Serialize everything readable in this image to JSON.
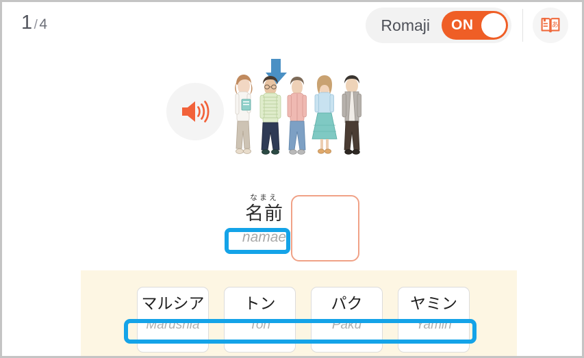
{
  "topbar": {
    "page_current": "1",
    "page_separator": "/",
    "page_total": "4",
    "romaji_label": "Romaji",
    "romaji_state": "ON",
    "dictionary_icon": "book-dictionary-icon"
  },
  "stage": {
    "audio_icon": "speaker-icon",
    "arrow_icon": "arrow-down-icon",
    "people_illustration": "five-standing-people-illustration",
    "people": [
      {
        "top_color": "#f4f2ef",
        "bottom_color": "#cdc3b4",
        "hair_color": "#c08a5e",
        "accent": "#8fd0c9"
      },
      {
        "top_color": "#dfeccb",
        "bottom_color": "#2e3a55",
        "hair_color": "#4a3b2f",
        "accent": "#c5d9a4"
      },
      {
        "top_color": "#efb9b2",
        "bottom_color": "#7da0c4",
        "hair_color": "#7d6a58",
        "accent": "#e0a79e"
      },
      {
        "top_color": "#c8e2f0",
        "bottom_color": "#7fc9c3",
        "hair_color": "#c9a271",
        "accent": "#9fd8d2"
      },
      {
        "top_color": "#b6b1ac",
        "bottom_color": "#4a3c33",
        "hair_color": "#3a3530",
        "accent": "#cfcac4"
      }
    ]
  },
  "answer": {
    "furigana": "なまえ",
    "kanji": "名前",
    "romaji": "namae",
    "slot_placeholder": "",
    "slot_border_color": "#f0a186",
    "highlight_color": "#14a3e8"
  },
  "choices": {
    "panel_color": "#fdf6e3",
    "cards": [
      {
        "jp": "マルシア",
        "ro": "Marushia"
      },
      {
        "jp": "トン",
        "ro": "Ton"
      },
      {
        "jp": "パク",
        "ro": "Paku"
      },
      {
        "jp": "ヤミン",
        "ro": "Yamin"
      }
    ]
  },
  "colors": {
    "accent_orange": "#ef5e26",
    "highlight_blue": "#14a3e8",
    "arrow_blue": "#4a90c4",
    "speaker_orange": "#f2623a",
    "panel_beige": "#fdf6e3",
    "frame_gray": "#c4c4c4"
  }
}
